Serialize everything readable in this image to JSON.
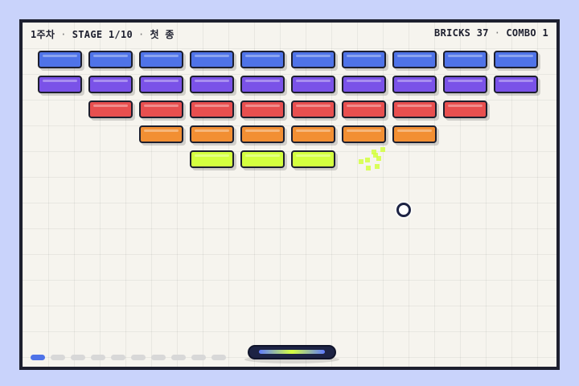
{
  "hud": {
    "week": "1주차",
    "stage": "STAGE 1/10",
    "mode": "첫 종",
    "bricks": "BRICKS 37",
    "combo": "COMBO 1",
    "separator": "·"
  },
  "colors": {
    "blue": "#4f73e8",
    "purple": "#7a52e8",
    "red": "#e84f4f",
    "orange": "#f28f33",
    "lime": "#d4ff3f",
    "outline": "#1d1f2e",
    "paddle": "#1d2344"
  },
  "rows": [
    {
      "color": "blue",
      "bricks": 10,
      "offset": 0
    },
    {
      "color": "purple",
      "bricks": 10,
      "offset": 0
    },
    {
      "color": "red",
      "bricks": 8,
      "offset": 1
    },
    {
      "color": "orange",
      "bricks": 6,
      "offset": 2
    },
    {
      "color": "lime",
      "bricks": 3,
      "offset": 3
    }
  ],
  "progress": {
    "total": 10,
    "current": 1
  },
  "icons": {
    "ball": "ball-icon",
    "paddle": "paddle-icon"
  }
}
